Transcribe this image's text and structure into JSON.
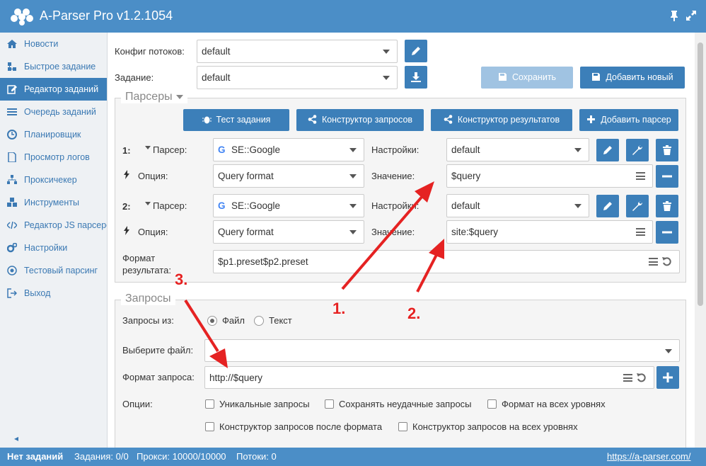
{
  "app": {
    "title": "A-Parser Pro v1.2.1054"
  },
  "sidebar": {
    "items": [
      {
        "label": "Новости",
        "icon": "home-icon"
      },
      {
        "label": "Быстрое задание",
        "icon": "sitemap-icon"
      },
      {
        "label": "Редактор заданий",
        "icon": "edit-icon",
        "active": true
      },
      {
        "label": "Очередь заданий",
        "icon": "list-icon"
      },
      {
        "label": "Планировщик",
        "icon": "clock-icon"
      },
      {
        "label": "Просмотр логов",
        "icon": "file-icon"
      },
      {
        "label": "Проксичекер",
        "icon": "sitemap-icon"
      },
      {
        "label": "Инструменты",
        "icon": "cubes-icon"
      },
      {
        "label": "Редактор JS парсеров",
        "icon": "code-icon"
      },
      {
        "label": "Настройки",
        "icon": "gears-icon"
      },
      {
        "label": "Тестовый парсинг",
        "icon": "target-icon"
      },
      {
        "label": "Выход",
        "icon": "sign-out-icon"
      }
    ],
    "collapse_glyph": "◂"
  },
  "top": {
    "threads_label": "Конфиг потоков:",
    "threads_value": "default",
    "task_label": "Задание:",
    "task_value": "default",
    "save_label": "Сохранить",
    "add_new_label": "Добавить новый"
  },
  "parsers": {
    "legend": "Парсеры",
    "buttons": {
      "test": "Тест задания",
      "query_builder": "Конструктор запросов",
      "result_builder": "Конструктор результатов",
      "add_parser": "Добавить парсер"
    },
    "rows": [
      {
        "num": "1:",
        "parser_label": "Парсер:",
        "parser_value": "SE::Google",
        "settings_label": "Настройки:",
        "settings_value": "default",
        "option_label": "Опция:",
        "option_value": "Query format",
        "value_label": "Значение:",
        "value_value": "$query"
      },
      {
        "num": "2:",
        "parser_label": "Парсер:",
        "parser_value": "SE::Google",
        "settings_label": "Настройки:",
        "settings_value": "default",
        "option_label": "Опция:",
        "option_value": "Query format",
        "value_label": "Значение:",
        "value_value": "site:$query"
      }
    ],
    "result_format_label_1": "Формат",
    "result_format_label_2": "результата:",
    "result_format_value": "$p1.preset$p2.preset"
  },
  "queries": {
    "legend": "Запросы",
    "from_label": "Запросы из:",
    "from_options": [
      "Файл",
      "Текст"
    ],
    "from_selected": "Файл",
    "file_label": "Выберите файл:",
    "file_value": "",
    "format_label": "Формат запроса:",
    "format_value": "http://$query",
    "options_label": "Опции:",
    "options": [
      "Уникальные запросы",
      "Сохранять неудачные запросы",
      "Формат на всех уровнях",
      "Конструктор запросов после формата",
      "Конструктор запросов на всех уровнях"
    ]
  },
  "status": {
    "no_tasks": "Нет заданий",
    "tasks": "Задания: 0/0",
    "proxy": "Прокси: 10000/10000",
    "threads": "Потоки: 0",
    "link": "https://a-parser.com/"
  },
  "annotations": [
    "1.",
    "2.",
    "3."
  ],
  "colors": {
    "accent": "#3c7fb9",
    "titlebar": "#4b8ec7",
    "annotation": "#e52222"
  }
}
